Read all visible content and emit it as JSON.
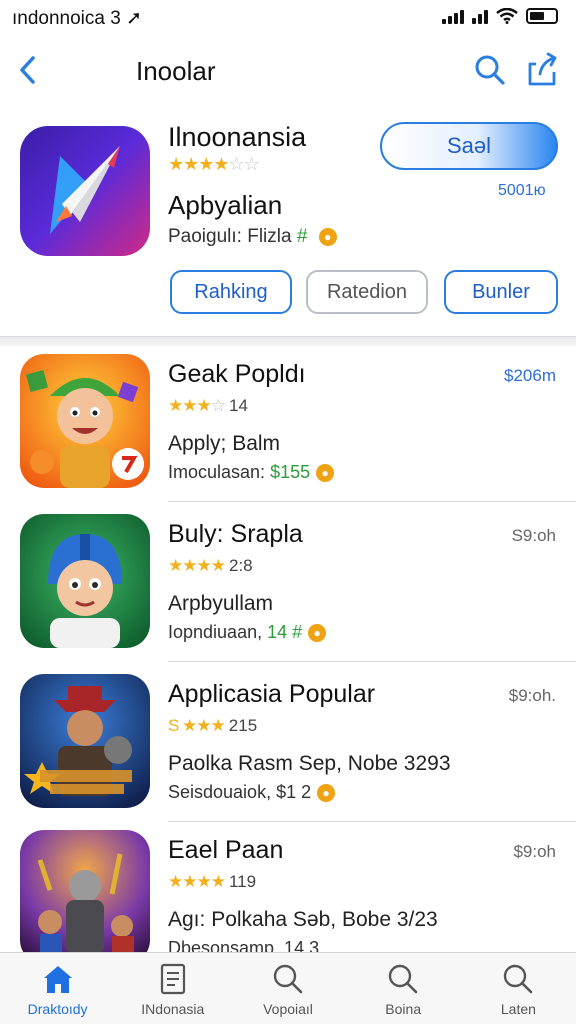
{
  "status_bar": {
    "carrier": "ındonnoica 3 ➚"
  },
  "nav": {
    "title": "Inoolar"
  },
  "featured": {
    "title": "Ilnoonansia",
    "subtitle": "Apbyalian",
    "meta_prefix": "Paoigulı: Flizla",
    "meta_green": "#",
    "get_label": "Saəl",
    "price": "5001ю",
    "chips": [
      "Rahking",
      "Ratedion",
      "Bunler"
    ],
    "accent_color": "#2a7de1"
  },
  "list": [
    {
      "name": "Geak Popldı",
      "stars": "★★★",
      "stars_off": "☆",
      "count": "14",
      "desc": "Apply; Balm",
      "meta_prefix": "Imoculasan:",
      "meta_green": "$155",
      "price": "$206m"
    },
    {
      "name": "Buly: Srapla",
      "stars": "★★★★",
      "stars_off": "",
      "count": "2:8",
      "desc": "Arpbyullam",
      "meta_prefix": "Iopndiuaan,",
      "meta_green": "14 #",
      "price": "S9:oh"
    },
    {
      "name": "Applicasia Popular",
      "stars": "S ★★★",
      "stars_off": "",
      "count": "215",
      "desc": "Paolka Rasm Sep, Nobe 3293",
      "meta_prefix": "Seisdouaiok, $1 2",
      "meta_green": "",
      "price": "$9:oh."
    },
    {
      "name": "Eael Paan",
      "stars": "★★★★",
      "stars_off": "",
      "count": "119",
      "desc": "Agı: Polkaha Səb, Bobe 3/23",
      "meta_prefix": "Dbesonsamp, 14 3",
      "meta_green": "",
      "price": "$9:oh"
    }
  ],
  "tabs": [
    {
      "label": "Draktoıdy",
      "icon": "home-icon",
      "active": true
    },
    {
      "label": "INdonasia",
      "icon": "document-icon",
      "active": false
    },
    {
      "label": "Vopoiaıl",
      "icon": "search-icon",
      "active": false
    },
    {
      "label": "Boina",
      "icon": "search-icon",
      "active": false
    },
    {
      "label": "Laten",
      "icon": "search-icon",
      "active": false
    }
  ]
}
